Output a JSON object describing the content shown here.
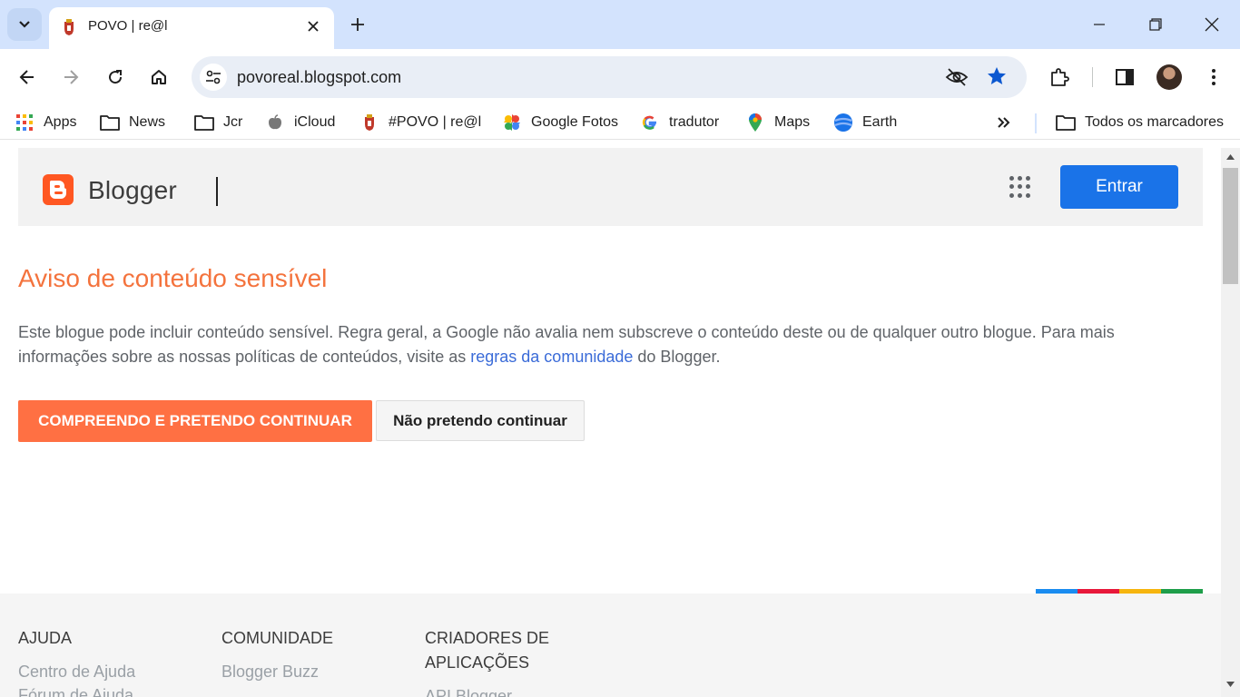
{
  "browser": {
    "tab": {
      "title": "POVO | re@l"
    },
    "address_bar": {
      "url": "povoreal.blogspot.com"
    }
  },
  "bookmarks": [
    {
      "label": "Apps",
      "icon": "apps-grid-icon"
    },
    {
      "label": "News",
      "icon": "folder-icon"
    },
    {
      "label": "Jcr",
      "icon": "folder-icon"
    },
    {
      "label": "iCloud",
      "icon": "apple-icon"
    },
    {
      "label": "#POVO | re@l",
      "icon": "crest-icon"
    },
    {
      "label": "Google Fotos",
      "icon": "pinwheel-icon"
    },
    {
      "label": "tradutor",
      "icon": "google-g-icon"
    },
    {
      "label": "Maps",
      "icon": "map-pin-icon"
    },
    {
      "label": "Earth",
      "icon": "globe-icon"
    }
  ],
  "bookmarks_all": {
    "label": "Todos os marcadores"
  },
  "header": {
    "brand": "Blogger",
    "signin_label": "Entrar",
    "brand_color": "#ff5722",
    "signin_color": "#1a73e8"
  },
  "warning": {
    "title": "Aviso de conteúdo sensível",
    "text_before_link": "Este blogue pode incluir conteúdo sensível. Regra geral, a Google não avalia nem subscreve o conteúdo deste ou de qualquer outro blogue. Para mais informações sobre as nossas políticas de conteúdos, visite as ",
    "link_text": "regras da comunidade",
    "text_after_link": " do Blogger.",
    "continue_label": "COMPREENDO E PRETENDO CONTINUAR",
    "leave_label": "Não pretendo continuar",
    "title_color": "#f4733d",
    "continue_color": "#ff7043"
  },
  "footer": {
    "columns": [
      {
        "heading": "AJUDA",
        "links": [
          "Centro de Ajuda",
          "Fórum de Ajuda"
        ]
      },
      {
        "heading": "COMUNIDADE",
        "links": [
          "Blogger Buzz"
        ]
      },
      {
        "heading_line1": "CRIADORES DE",
        "heading_line2": "APLICAÇÕES",
        "links": [
          "API Blogger"
        ]
      }
    ],
    "colorbar": [
      "#1a8cf0",
      "#e8183a",
      "#f6b50e",
      "#1e9e4a"
    ]
  }
}
